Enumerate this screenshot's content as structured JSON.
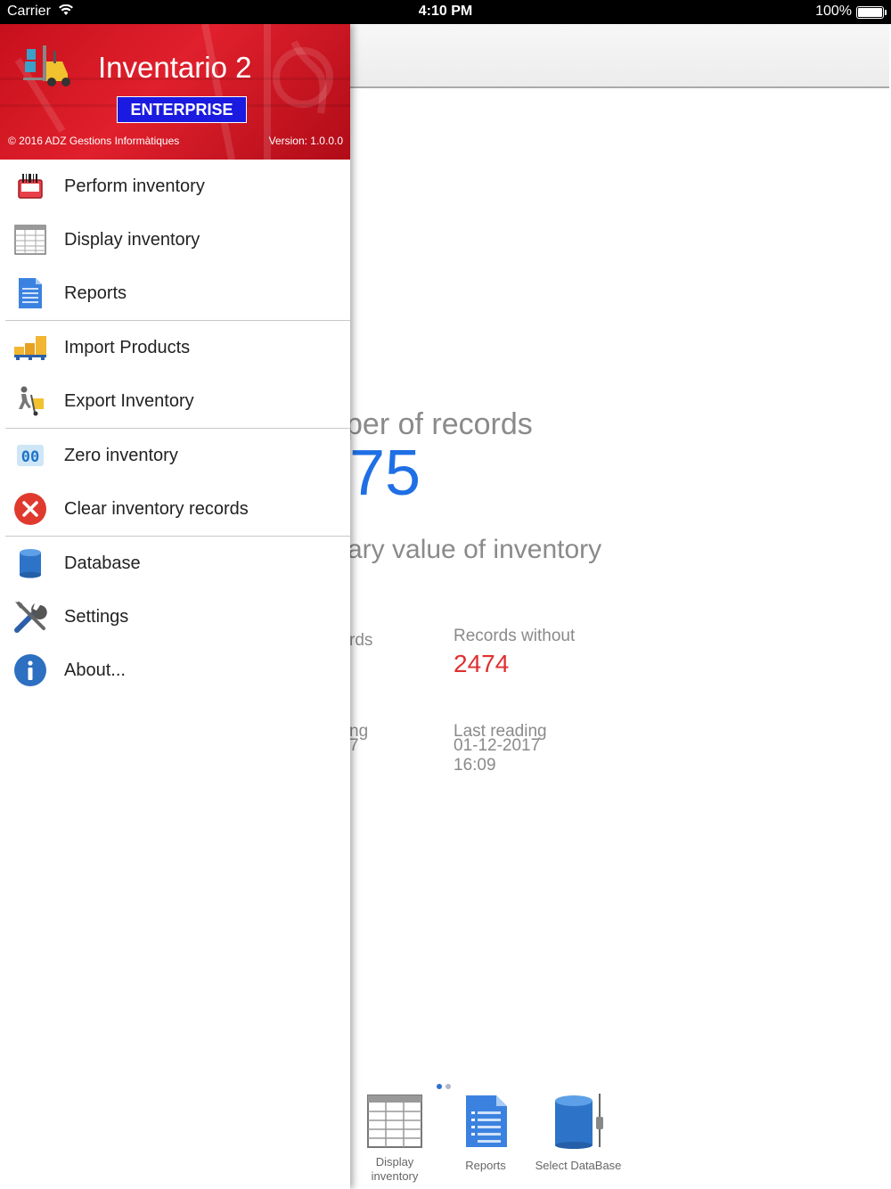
{
  "status_bar": {
    "carrier": "Carrier",
    "time": "4:10 PM",
    "battery": "100%"
  },
  "drawer": {
    "app_title": "Inventario 2",
    "edition": "ENTERPRISE",
    "copyright": "© 2016 ADZ Gestions Informàtiques",
    "version": "Version: 1.0.0.0",
    "menu": [
      {
        "label": "Perform inventory",
        "icon": "barcode-scanner-icon"
      },
      {
        "label": "Display inventory",
        "icon": "table-grid-icon"
      },
      {
        "label": "Reports",
        "icon": "report-document-icon"
      },
      {
        "label": "Import Products",
        "icon": "pallet-boxes-icon"
      },
      {
        "label": "Export Inventory",
        "icon": "hand-truck-icon"
      },
      {
        "label": "Zero inventory",
        "icon": "zero-counter-icon"
      },
      {
        "label": "Clear inventory records",
        "icon": "close-circle-icon"
      },
      {
        "label": "Database",
        "icon": "database-icon"
      },
      {
        "label": "Settings",
        "icon": "tools-icon"
      },
      {
        "label": "About...",
        "icon": "info-icon"
      }
    ]
  },
  "main": {
    "records_label": "per of records",
    "records_value": "75",
    "value_label": "ary value of inventory",
    "records_partial": "rds",
    "without_label": "Records without",
    "without_value": "2474",
    "first_partial": "ng",
    "first_partial2": "7",
    "last_label": "Last reading",
    "last_date": "01-12-2017",
    "last_time": "16:09",
    "toolbar": [
      {
        "label": "Display\ninventory",
        "icon": "table-grid-icon"
      },
      {
        "label": "Reports",
        "icon": "report-document-icon"
      },
      {
        "label": "Select DataBase",
        "icon": "database-icon"
      }
    ]
  }
}
